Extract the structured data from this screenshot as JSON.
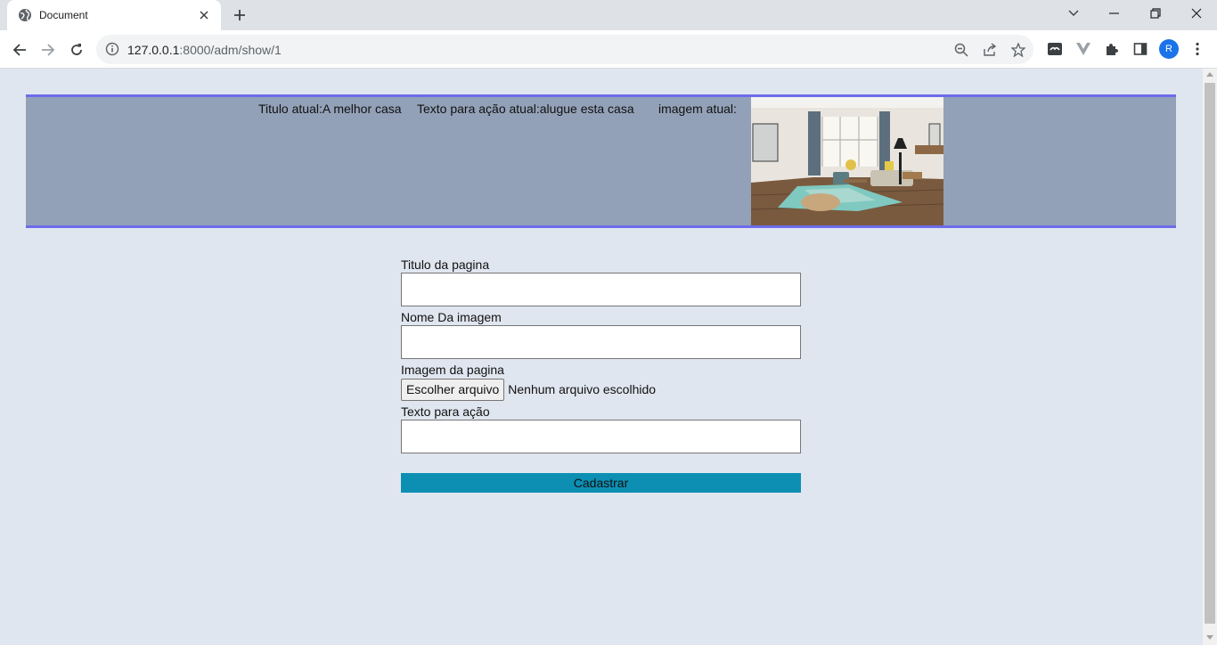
{
  "browser": {
    "tab_title": "Document",
    "url_host": "127.0.0.1",
    "url_path": ":8000/adm/show/1",
    "profile_initial": "R"
  },
  "banner": {
    "title_label": "Titulo atual:",
    "title_value": "A melhor casa",
    "action_label": "Texto para ação atual:",
    "action_value": "alugue esta casa",
    "image_label": "imagem atual:"
  },
  "form": {
    "title_label": "Titulo da pagina",
    "title_value": "",
    "image_name_label": "Nome Da imagem",
    "image_name_value": "",
    "image_file_label": "Imagem da pagina",
    "file_button": "Escolher arquivo",
    "file_status": "Nenhum arquivo escolhido",
    "action_label": "Texto para ação",
    "action_value": "",
    "submit_label": "Cadastrar"
  },
  "colors": {
    "page_bg": "#e0e6ef",
    "banner_bg": "#93a1b8",
    "banner_border": "#6c6cec",
    "submit_bg": "#0c8fb3"
  }
}
